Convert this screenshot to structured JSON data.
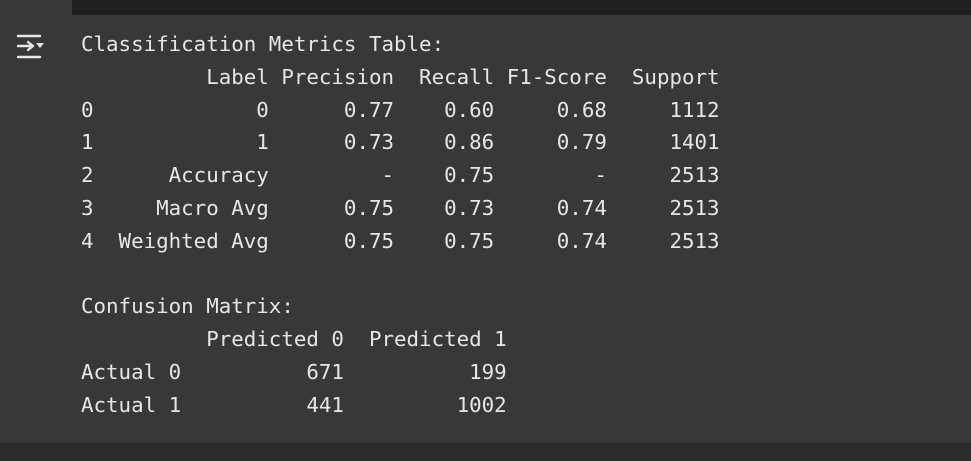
{
  "output": {
    "icon": "output-toggle-icon",
    "text_color": "#e6e6e6",
    "background": "#383838",
    "lines": [
      "Classification Metrics Table:",
      "          Label Precision  Recall F1-Score  Support",
      "0             0      0.77    0.60     0.68     1112",
      "1             1      0.73    0.86     0.79     1401",
      "2      Accuracy         -    0.75        -     2513",
      "3     Macro Avg      0.75    0.73     0.74     2513",
      "4  Weighted Avg      0.75    0.75     0.74     2513",
      "",
      "Confusion Matrix:",
      "          Predicted 0  Predicted 1",
      "Actual 0          671          199",
      "Actual 1          441         1002"
    ]
  }
}
